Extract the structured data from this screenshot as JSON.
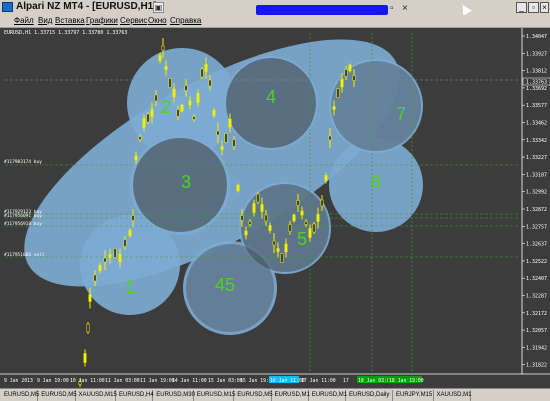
{
  "window": {
    "title": "Alpari NZ MT4 - [EURUSD,H1]",
    "controls": {
      "minimize": "_",
      "restore": "▫",
      "close": "×"
    },
    "mdi_controls": {
      "minimize": "_",
      "restore": "▫",
      "close": "×"
    }
  },
  "menu": [
    {
      "label": "Файл"
    },
    {
      "label": "Вид"
    },
    {
      "label": "Вставка"
    },
    {
      "label": "Графики"
    },
    {
      "label": "Сервис"
    },
    {
      "label": "Окно"
    },
    {
      "label": "Справка"
    }
  ],
  "chart": {
    "symbol_info": "EURUSD,H1  1.33715 1.33797 1.33780 1.33763",
    "colors": {
      "background": "#3c3c3c",
      "candle": "#f0f000",
      "zone_fill": "#7eaad3",
      "zone_number": "#4dd617",
      "price_axis": "#ffffff",
      "grid": "#00a000"
    },
    "price_labels": [
      "1.34047",
      "1.33927",
      "1.33812",
      "1.33692",
      "1.33577",
      "1.33462",
      "1.33342",
      "1.33227",
      "1.33107",
      "1.32992",
      "1.32872",
      "1.32757",
      "1.32637",
      "1.32522",
      "1.32407",
      "1.32287",
      "1.32172",
      "1.32057",
      "1.31942",
      "1.31822"
    ],
    "current_price": "1.33763",
    "order_labels": [
      "#117903174 buy",
      "#117929123 buy",
      "#117956091 buy",
      "#117956918 buy",
      "#117951066 sell"
    ],
    "zone_numbers": [
      "1",
      "2",
      "3",
      "4",
      "45",
      "5",
      "6",
      "7"
    ],
    "time_labels": [
      "9 Jan 2013",
      "9 Jan 19:00",
      "10 Jan 11:00",
      "11 Jan 03:00",
      "11 Jan 19:00",
      "14 Jan 11:00",
      "15 Jan 03:00",
      "15 Jan 19:00",
      "16 Jan 11:00",
      "17 Jan 11:00",
      "17",
      "18 Jan 03:00",
      "18 Jan 19:00"
    ]
  },
  "tabs": [
    "EURUSD,M5",
    "EURUSD,M5",
    "XAUUSD,M15",
    "EURUSD,H4",
    "EURUSD,M30",
    "EURUSD,M15",
    "EURUSD,M5",
    "EURUSD,M1",
    "EURUSD,M1",
    "EURUSD,Daily",
    "EURJPY,M15",
    "XAUUSD,M1"
  ]
}
